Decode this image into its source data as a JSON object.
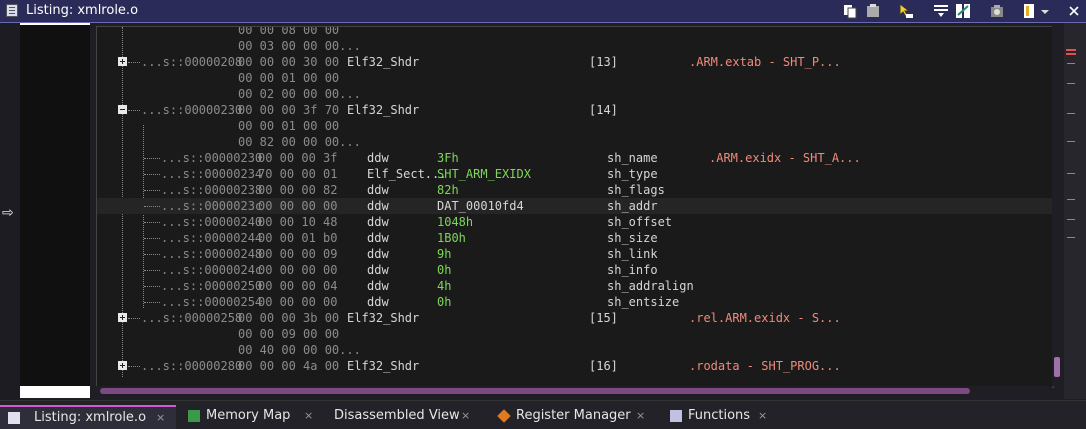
{
  "window": {
    "title": "Listing:  xmlrole.o"
  },
  "toolbar_icons": [
    "copy-icon",
    "paste-icon",
    "cursor-icon",
    "navigation-icon",
    "diff-icon",
    "snapshot-icon",
    "edit-icon",
    "dropdown-icon",
    "close-icon"
  ],
  "rows": [
    {
      "type": "cont",
      "bytes": "00 00 08 00 00"
    },
    {
      "type": "cont",
      "bytes": "00 03 00 00 00..."
    },
    {
      "type": "struct",
      "expand": "plus",
      "addr": "...s::00000208",
      "bytes": "00 00 00 30 00",
      "mnemonic": "Elf32_Shdr",
      "index": "[13]",
      "comment": ".ARM.extab - SHT_P..."
    },
    {
      "type": "cont",
      "bytes": "00 00 01 00 00"
    },
    {
      "type": "cont",
      "bytes": "00 02 00 00 00..."
    },
    {
      "type": "struct",
      "expand": "minus",
      "addr": "...s::00000230",
      "bytes": "00 00 00 3f 70",
      "mnemonic": "Elf32_Shdr",
      "index": "[14]",
      "comment": ""
    },
    {
      "type": "cont",
      "bytes": "00 00 01 00 00"
    },
    {
      "type": "cont",
      "bytes": "00 82 00 00 00..."
    },
    {
      "type": "field",
      "addr": "...s::00000230",
      "bytes": "00 00 00 3f",
      "mnemonic": "ddw",
      "operand": "3Fh",
      "operand_style": "val",
      "field": "sh_name",
      "comment": ".ARM.exidx - SHT_A..."
    },
    {
      "type": "field",
      "addr": "...s::00000234",
      "bytes": "70 00 00 01",
      "mnemonic": "Elf_Sect...",
      "operand": "SHT_ARM_EXIDX",
      "operand_style": "val",
      "field": "sh_type",
      "comment": ""
    },
    {
      "type": "field",
      "addr": "...s::00000238",
      "bytes": "00 00 00 82",
      "mnemonic": "ddw",
      "operand": "82h",
      "operand_style": "val",
      "field": "sh_flags",
      "comment": ""
    },
    {
      "type": "field",
      "addr": "...s::0000023c",
      "bytes": "00 00 00 00",
      "mnemonic": "ddw",
      "operand": "DAT_00010fd4",
      "operand_style": "plain",
      "field": "sh_addr",
      "comment": "",
      "highlight": true
    },
    {
      "type": "field",
      "addr": "...s::00000240",
      "bytes": "00 00 10 48",
      "mnemonic": "ddw",
      "operand": "1048h",
      "operand_style": "val",
      "field": "sh_offset",
      "comment": ""
    },
    {
      "type": "field",
      "addr": "...s::00000244",
      "bytes": "00 00 01 b0",
      "mnemonic": "ddw",
      "operand": "1B0h",
      "operand_style": "val",
      "field": "sh_size",
      "comment": ""
    },
    {
      "type": "field",
      "addr": "...s::00000248",
      "bytes": "00 00 00 09",
      "mnemonic": "ddw",
      "operand": "9h",
      "operand_style": "val",
      "field": "sh_link",
      "comment": ""
    },
    {
      "type": "field",
      "addr": "...s::0000024c",
      "bytes": "00 00 00 00",
      "mnemonic": "ddw",
      "operand": "0h",
      "operand_style": "val",
      "field": "sh_info",
      "comment": ""
    },
    {
      "type": "field",
      "addr": "...s::00000250",
      "bytes": "00 00 00 04",
      "mnemonic": "ddw",
      "operand": "4h",
      "operand_style": "val",
      "field": "sh_addralign",
      "comment": ""
    },
    {
      "type": "field",
      "addr": "...s::00000254",
      "bytes": "00 00 00 00",
      "mnemonic": "ddw",
      "operand": "0h",
      "operand_style": "val",
      "field": "sh_entsize",
      "comment": "",
      "last": true
    },
    {
      "type": "struct",
      "expand": "plus",
      "addr": "...s::00000258",
      "bytes": "00 00 00 3b 00",
      "mnemonic": "Elf32_Shdr",
      "index": "[15]",
      "comment": ".rel.ARM.exidx - S..."
    },
    {
      "type": "cont",
      "bytes": "00 00 09 00 00"
    },
    {
      "type": "cont",
      "bytes": "00 40 00 00 00..."
    },
    {
      "type": "struct",
      "expand": "plus",
      "addr": "...s::00000280",
      "bytes": "00 00 00 4a 00",
      "mnemonic": "Elf32_Shdr",
      "index": "[16]",
      "comment": ".rodata - SHT_PROG..."
    }
  ],
  "tabs": [
    {
      "label": "Listing:  xmlrole.o",
      "icon": "listing-icon",
      "close": "×",
      "active": true
    },
    {
      "label": "Memory Map",
      "icon": "memory-map-icon",
      "close": "×"
    },
    {
      "label": "Disassembled View",
      "icon": "",
      "close": "×"
    },
    {
      "label": "Register Manager",
      "icon": "register-icon",
      "close": "×"
    },
    {
      "label": "Functions",
      "icon": "functions-icon",
      "close": "×"
    }
  ],
  "colors": {
    "value": "#7fd65a",
    "comment": "#f08a7a",
    "accent": "#d25ad0"
  }
}
